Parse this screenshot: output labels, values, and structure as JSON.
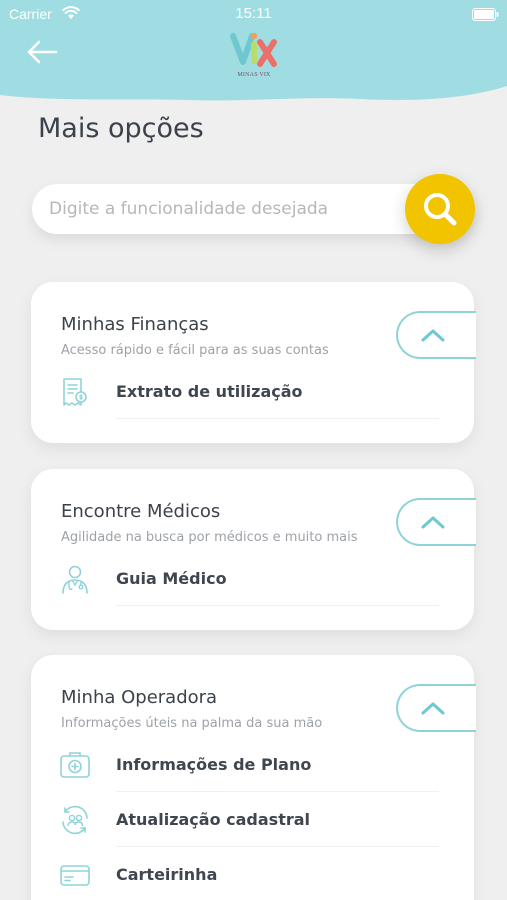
{
  "status_bar": {
    "carrier": "Carrier",
    "time": "15:11"
  },
  "header": {
    "logo_caption": "MINAS VIX",
    "colors": {
      "accent": "#9fdde2",
      "search": "#f2c400",
      "outline": "#8fd3d8"
    },
    "icons": {
      "back": "arrow-left-icon",
      "search": "magnifier-icon"
    }
  },
  "page": {
    "title": "Mais opções"
  },
  "search": {
    "placeholder": "Digite a funcionalidade desejada",
    "value": ""
  },
  "sections": [
    {
      "title": "Minhas Finanças",
      "subtitle": "Acesso rápido e fácil para as suas contas",
      "expanded": true,
      "items": [
        {
          "label": "Extrato de utilização",
          "icon": "statement-icon"
        }
      ]
    },
    {
      "title": "Encontre Médicos",
      "subtitle": "Agilidade na busca por médicos e muito mais",
      "expanded": true,
      "items": [
        {
          "label": "Guia Médico",
          "icon": "doctor-icon"
        }
      ]
    },
    {
      "title": "Minha Operadora",
      "subtitle": "Informações úteis na palma da sua mão",
      "expanded": true,
      "items": [
        {
          "label": "Informações de Plano",
          "icon": "plan-info-icon"
        },
        {
          "label": "Atualização cadastral",
          "icon": "profile-update-icon"
        },
        {
          "label": "Carteirinha",
          "icon": "member-card-icon"
        }
      ]
    }
  ]
}
